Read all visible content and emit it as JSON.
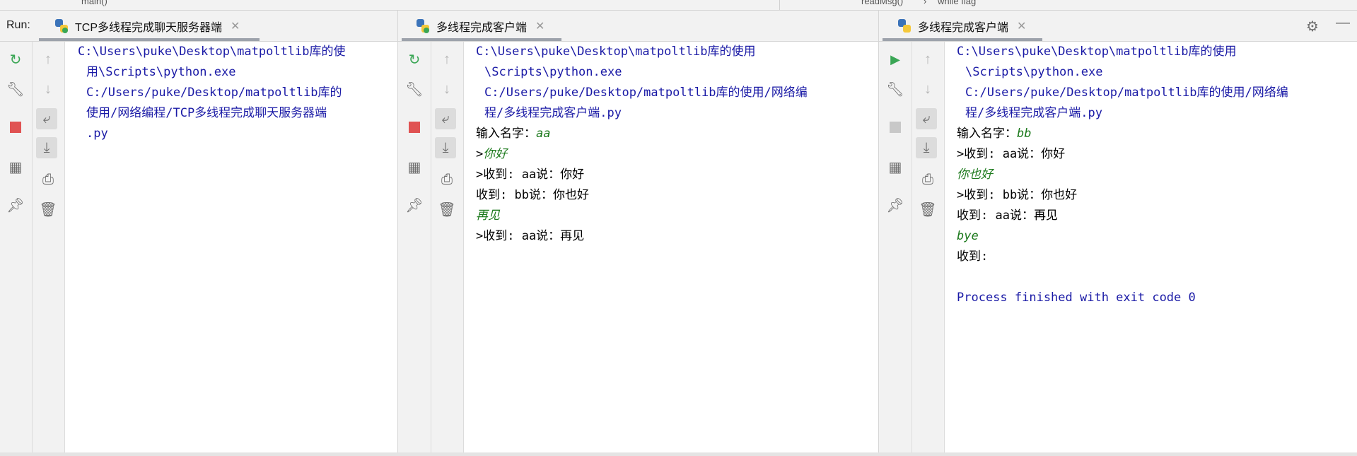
{
  "breadcrumbs": {
    "left": "main()",
    "right_func": "readMsg()",
    "right_sep": "›",
    "right_loop": "while flag"
  },
  "run_label": "Run:",
  "tabs": [
    {
      "label": "TCP多线程完成聊天服务器端",
      "close": "✕"
    },
    {
      "label": "多线程完成客户端",
      "close": "✕"
    },
    {
      "label": "多线程完成客户端",
      "close": "✕"
    }
  ],
  "icons": {
    "rerun": "rerun-icon",
    "wrench": "wrench-icon",
    "stop": "stop-icon",
    "layout": "layout-icon",
    "pin": "pin-icon",
    "up": "arrow-up-icon",
    "down": "arrow-down-icon",
    "softwrap": "soft-wrap-icon",
    "scrollend": "scroll-to-end-icon",
    "print": "print-icon",
    "trash": "trash-icon",
    "run": "run-icon",
    "gear": "gear-icon",
    "minimize": "minimize-icon"
  },
  "colors": {
    "path_text": "#1a1aa6",
    "user_input": "#1d7a1d",
    "stop_active": "#e05252",
    "run_green": "#3aa655"
  },
  "server_console": {
    "path1": "C:\\Users\\puke\\Desktop\\matpoltlib库的使",
    "path2": "用\\Scripts\\python.exe",
    "path3": "C:/Users/puke/Desktop/matpoltlib库的",
    "path4": "使用/网络编程/TCP多线程完成聊天服务器端",
    "path5": ".py"
  },
  "client1_console": {
    "path1": "C:\\Users\\puke\\Desktop\\matpoltlib库的使用",
    "path2": "\\Scripts\\python.exe",
    "path3": "C:/Users/puke/Desktop/matpoltlib库的使用/网络编",
    "path4": "程/多线程完成客户端.py",
    "name_prompt": "输入名字：",
    "name_value": "aa",
    "l1_prefix": ">",
    "l1_input": "你好",
    "l2": ">收到: aa说：你好",
    "l3": "收到: bb说：你也好",
    "l4_input": "再见",
    "l5": ">收到: aa说：再见"
  },
  "client2_console": {
    "path1": "C:\\Users\\puke\\Desktop\\matpoltlib库的使用",
    "path2": "\\Scripts\\python.exe",
    "path3": "C:/Users/puke/Desktop/matpoltlib库的使用/网络编",
    "path4": "程/多线程完成客户端.py",
    "name_prompt": "输入名字：",
    "name_value": "bb",
    "l1": ">收到: aa说：你好",
    "l2_input": "你也好",
    "l3": ">收到: bb说：你也好",
    "l4": "收到: aa说：再见",
    "l5_input": "bye",
    "l6": "收到:",
    "exit": "Process finished with exit code 0"
  }
}
